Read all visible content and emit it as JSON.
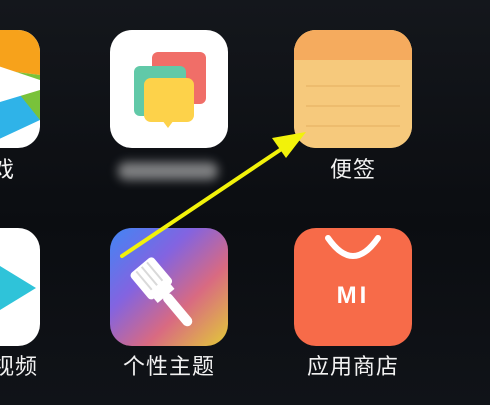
{
  "apps": {
    "partial_top_left": {
      "label": "戏"
    },
    "blurred_app": {
      "label": ""
    },
    "notes": {
      "label": "便签"
    },
    "partial_bottom_left": {
      "label": "视频"
    },
    "themes": {
      "label": "个性主题"
    },
    "app_store": {
      "label": "应用商店",
      "logo_text": "MI"
    }
  },
  "colors": {
    "arrow": "#f2f20a",
    "notes_header": "#f5ab5e",
    "notes_body": "#f6c97c",
    "store_bg": "#f76b49"
  }
}
